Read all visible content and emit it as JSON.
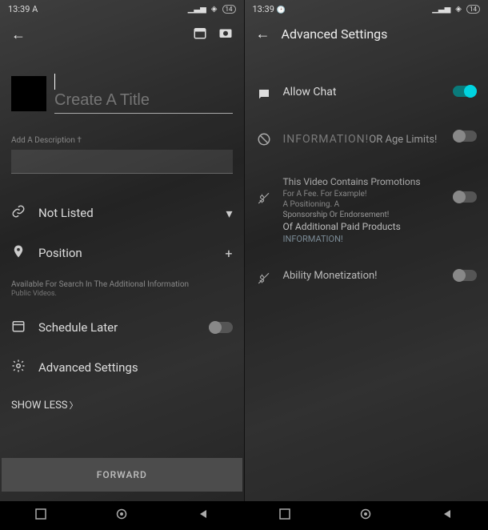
{
  "status": {
    "time_left": "13:39 A",
    "time_right": "13:39",
    "alarm": "⏰",
    "signal": "▲",
    "wifi": "◉",
    "battery": "14"
  },
  "left": {
    "title_placeholder": "Create A Title",
    "desc_label": "Add A Description †",
    "privacy": {
      "label": "Not Listed"
    },
    "position": {
      "label": "Position"
    },
    "search_info": "Available For Search In The Additional Information",
    "search_info_sub": "Public Videos.",
    "schedule": {
      "label": "Schedule Later"
    },
    "advanced": {
      "label": "Advanced Settings"
    },
    "show_less": "SHOW LESS",
    "forward": "FORWARD"
  },
  "right": {
    "header": "Advanced Settings",
    "allow_chat": "Allow Chat",
    "age_overlay": "INFORMATION!",
    "age_label": "OR Age Limits!",
    "promo_title": "This Video Contains Promotions",
    "promo_sub1": "For A Fee. For Example!",
    "promo_sub2": "A Positioning. A",
    "promo_sub3": "Sponsorship Or Endorsement!",
    "promo_sub4": "Of Additional Paid Products",
    "promo_info": "INFORMATION!",
    "monetization": "Ability Monetization!"
  }
}
